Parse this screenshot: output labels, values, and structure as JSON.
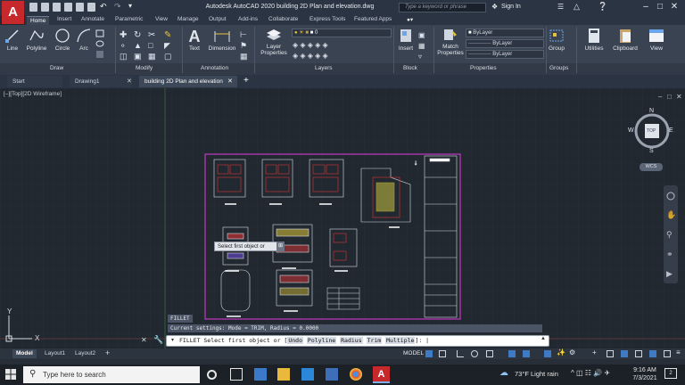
{
  "app": {
    "logo": "A",
    "window_title": "Autodesk AutoCAD 2020    building 2D Plan and elevation.dwg",
    "search_placeholder": "Type a keyword or phrase",
    "sign_in": "Sign In"
  },
  "ribbon_tabs": [
    "Home",
    "Insert",
    "Annotate",
    "Parametric",
    "View",
    "Manage",
    "Output",
    "Add-ins",
    "Collaborate",
    "Express Tools",
    "Featured Apps"
  ],
  "ribbon": {
    "draw": [
      "Line",
      "Polyline",
      "Circle",
      "Arc"
    ],
    "annotation": [
      "Text",
      "Dimension"
    ],
    "layers": [
      "Layer Properties"
    ],
    "layer_current": "0",
    "block": "Insert",
    "match_properties": "Match Properties",
    "properties_values": [
      "ByLayer",
      "ByLayer",
      "ByLayer"
    ],
    "group": "Group",
    "utilities": "Utilities",
    "clipboard": "Clipboard",
    "view": "View",
    "panel_labels": [
      "Draw",
      "Modify",
      "Annotation",
      "Layers",
      "Block",
      "Properties",
      "Groups"
    ]
  },
  "doc_tabs": [
    "Start",
    "Drawing1",
    "building 2D Plan and elevation"
  ],
  "viewport": {
    "label": "[–][Top][2D Wireframe]",
    "viewcube": {
      "top": "TOP",
      "n": "N",
      "s": "S",
      "e": "E",
      "w": "W"
    },
    "wcs": "WCS",
    "ucs_x": "X",
    "ucs_y": "Y"
  },
  "tooltip": "Select first object or",
  "command": {
    "history_1": "FILLET",
    "history_2": "Current settings: Mode = TRIM, Radius = 0.0000",
    "prefix": "FILLET Select first object or [",
    "options": [
      "Undo",
      "Polyline",
      "Radius",
      "Trim",
      "Multiple"
    ],
    "suffix": "]: |"
  },
  "layout_tabs": [
    "Model",
    "Layout1",
    "Layout2"
  ],
  "status": {
    "model": "MODEL"
  },
  "taskbar": {
    "search_placeholder": "Type here to search",
    "weather": "73°F  Light rain",
    "time": "9:16 AM",
    "date": "7/3/2021"
  },
  "colors": {
    "accent_red": "#c6282b",
    "magenta_frame": "#c03bc0",
    "background": "#212830",
    "ribbon": "#3a4352"
  }
}
